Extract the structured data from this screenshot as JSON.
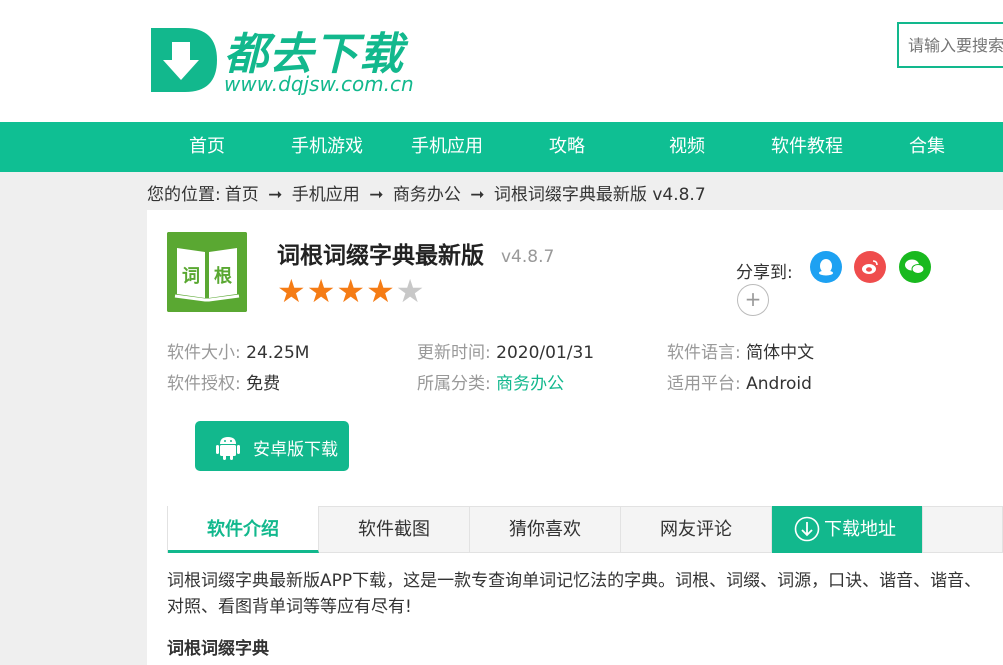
{
  "header": {
    "logo_title": "都去下载",
    "logo_url": "www.dqjsw.com.cn",
    "search_placeholder": "请输入要搜索"
  },
  "nav": {
    "items": [
      "首页",
      "手机游戏",
      "手机应用",
      "攻略",
      "视频",
      "软件教程",
      "合集"
    ]
  },
  "breadcrumb": {
    "prefix": "您的位置:",
    "items": [
      "首页",
      "手机应用",
      "商务办公",
      "词根词缀字典最新版 v4.8.7"
    ],
    "separator": "➞"
  },
  "app": {
    "icon_text": [
      "词",
      "根"
    ],
    "name": "词根词缀字典最新版",
    "version": "v4.8.7",
    "rating": 4,
    "rating_max": 5,
    "share_label": "分享到:",
    "share_more": "+",
    "info": {
      "size_label": "软件大小:",
      "size": "24.25M",
      "update_label": "更新时间:",
      "update": "2020/01/31",
      "lang_label": "软件语言:",
      "lang": "简体中文",
      "license_label": "软件授权:",
      "license": "免费",
      "category_label": "所属分类:",
      "category": "商务办公",
      "platform_label": "适用平台:",
      "platform": "Android"
    },
    "download_label": "安卓版下载"
  },
  "tabs": [
    "软件介绍",
    "软件截图",
    "猜你喜欢",
    "网友评论",
    "下载地址"
  ],
  "content": {
    "description": "词根词缀字典最新版APP下载，这是一款专查询单词记忆法的字典。词根、词缀、词源，口诀、谐音、谐音、对照、看图背单词等等应有尽有!",
    "subtitle": "词根词缀字典"
  },
  "colors": {
    "brand": "#12b88d",
    "star_on": "#f57c15",
    "qq": "#1da1f2",
    "weibo": "#ef4d4d",
    "wechat": "#19b91f"
  }
}
